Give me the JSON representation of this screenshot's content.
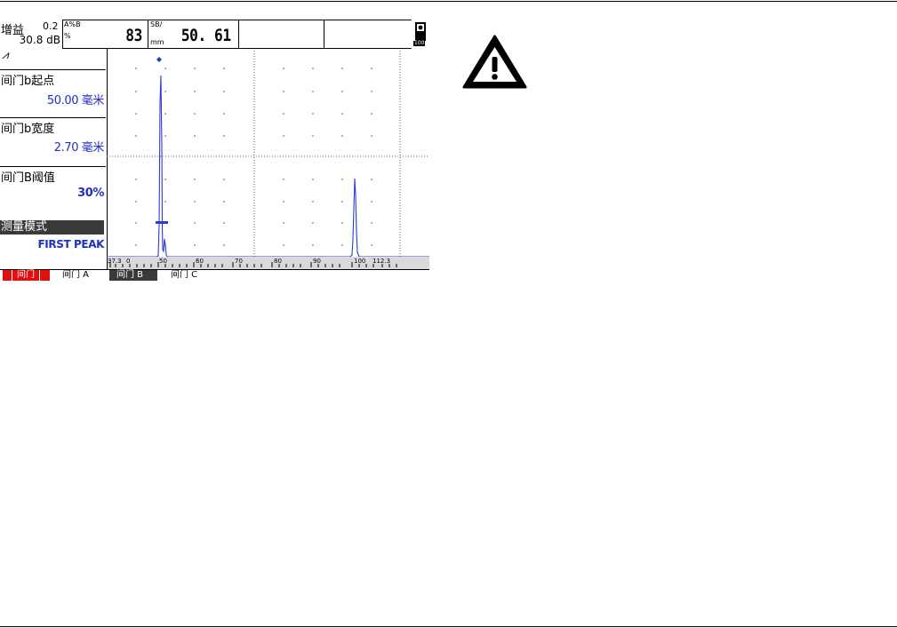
{
  "header": {
    "gain_label": "增益",
    "gain_step": "0.2",
    "gain_value": "30.8 dB",
    "box1_unit_top": "A%B",
    "box1_unit_bottom": "%",
    "box1_value": "83",
    "box2_unit_top": "SB/",
    "box2_unit_bottom": "mm",
    "box2_value": "50. 61",
    "battery_value": "100"
  },
  "rectify_symbol": "⩘",
  "menu": [
    {
      "label": "间门b起点",
      "value": "50.00 毫米"
    },
    {
      "label": "间门b宽度",
      "value": "2.70 毫米"
    },
    {
      "label": "间门B阈值",
      "value": "30%"
    },
    {
      "label": "测量模式",
      "value": "FIRST PEAK"
    }
  ],
  "scale": {
    "start": "37.3",
    "end": "112.3",
    "tick_labels": [
      "0",
      "50",
      "60",
      "70",
      "80",
      "90",
      "100"
    ]
  },
  "tabs": [
    {
      "label": "间门",
      "style": "active-red"
    },
    {
      "label": "间门 A",
      "style": "plain"
    },
    {
      "label": "间门 B",
      "style": "dark"
    },
    {
      "label": "间门 C",
      "style": "plain"
    }
  ],
  "warning": {
    "icon": "warning-triangle-icon"
  },
  "colors": {
    "signal": "#2a3bd0",
    "value_text": "#1f30c0",
    "tab_active": "#e01010",
    "menu_highlight": "#3a3a3a"
  }
}
